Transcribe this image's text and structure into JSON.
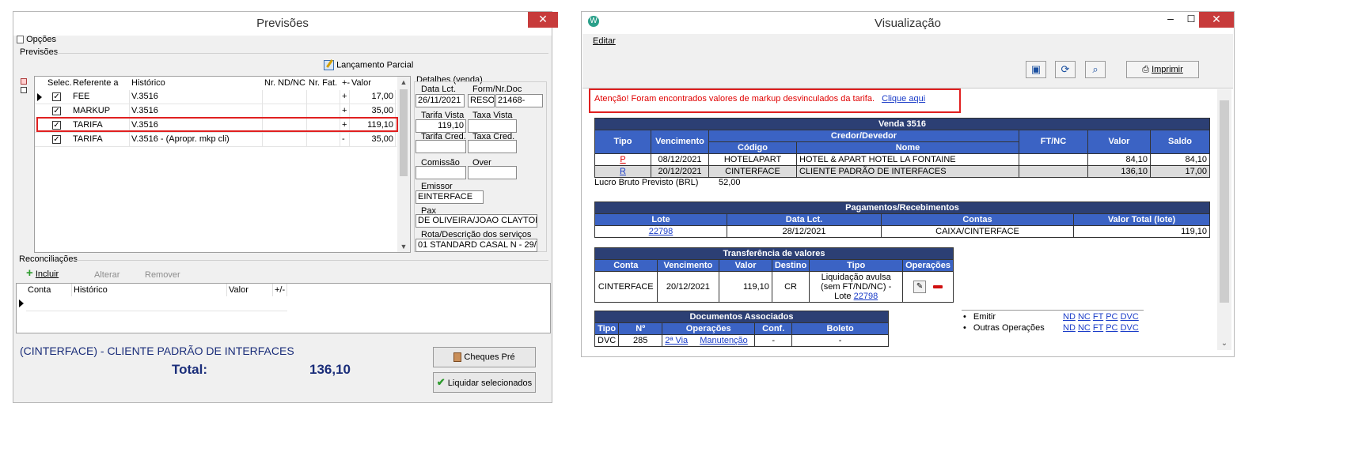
{
  "previsoes": {
    "title": "Previsões",
    "close": "✕",
    "menu_opcoes": "Opções",
    "group_previsoes": "Previsões",
    "lancamento_parcial": "Lançamento Parcial",
    "grid": {
      "headers": [
        "Selec.",
        "Referente a",
        "Histórico",
        "Nr. ND/NC",
        "Nr. Fat.",
        "+-",
        "Valor"
      ],
      "rows": [
        {
          "ref": "FEE",
          "hist": "V.3516",
          "sign": "+",
          "valor": "17,00"
        },
        {
          "ref": "MARKUP",
          "hist": "V.3516",
          "sign": "+",
          "valor": "35,00"
        },
        {
          "ref": "TARIFA",
          "hist": "V.3516",
          "sign": "+",
          "valor": "119,10"
        },
        {
          "ref": "TARIFA",
          "hist": "V.3516 - (Apropr. mkp cli)",
          "sign": "-",
          "valor": "35,00"
        }
      ]
    },
    "detalhes": {
      "title": "Detalhes (venda)",
      "data_lct_label": "Data Lct.",
      "data_lct": "26/11/2021",
      "form_label": "Form/Nr.Doc",
      "form": "RESO",
      "nrdoc": "21468-",
      "tarifa_vista_label": "Tarifa Vista",
      "tarifa_vista": "119,10",
      "taxa_vista_label": "Taxa Vista",
      "tarifa_cred_label": "Tarifa Cred.",
      "taxa_cred_label": "Taxa Cred.",
      "comissao_label": "Comissão",
      "over_label": "Over",
      "emissor_label": "Emissor",
      "emissor": "EINTERFACE",
      "pax_label": "Pax",
      "pax": "DE OLIVEIRA/JOAO CLAYTON",
      "rota_label": "Rota/Descrição dos serviços",
      "rota": "01 STANDARD CASAL  N  - 29/11"
    },
    "reconciliacoes": {
      "title": "Reconciliações",
      "incluir": "Incluir",
      "alterar": "Alterar",
      "remover": "Remover",
      "headers": [
        "Conta",
        "Histórico",
        "Valor",
        "+/-"
      ]
    },
    "client": "(CINTERFACE) - CLIENTE PADRÃO DE INTERFACES",
    "total_label": "Total:",
    "total_value": "136,10",
    "cheques_pre": "Cheques Pré",
    "liquidar": "Liquidar selecionados"
  },
  "visualizacao": {
    "title": "Visualização",
    "menu_editar": "Editar",
    "imprimir": "Imprimir",
    "warning": "Atenção! Foram encontrados valores de markup desvinculados da tarifa.",
    "warning_link": "Clique aqui",
    "venda": {
      "title": "Venda  3516",
      "headers": {
        "tipo": "Tipo",
        "vencimento": "Vencimento",
        "credor": "Credor/Devedor",
        "codigo": "Código",
        "nome": "Nome",
        "ftnc": "FT/NC",
        "valor": "Valor",
        "saldo": "Saldo"
      },
      "rows": [
        {
          "tipo": "P",
          "vencimento": "08/12/2021",
          "codigo": "HOTELAPART",
          "nome": "HOTEL & APART HOTEL LA FONTAINE",
          "ftnc": "",
          "valor": "84,10",
          "saldo": "84,10"
        },
        {
          "tipo": "R",
          "vencimento": "20/12/2021",
          "codigo": "CINTERFACE",
          "nome": "CLIENTE PADRÃO DE INTERFACES",
          "ftnc": "",
          "valor": "136,10",
          "saldo": "17,00"
        }
      ]
    },
    "lucro_label": "Lucro Bruto Previsto (BRL)",
    "lucro_value": "52,00",
    "pagamentos": {
      "title": "Pagamentos/Recebimentos",
      "headers": [
        "Lote",
        "Data Lct.",
        "Contas",
        "Valor Total (lote)"
      ],
      "row": {
        "lote": "22798",
        "data": "28/12/2021",
        "contas": "CAIXA/CINTERFACE",
        "valor": "119,10"
      }
    },
    "transferencia": {
      "title": "Transferência de valores",
      "headers": [
        "Conta",
        "Vencimento",
        "Valor",
        "Destino",
        "Tipo",
        "Operações"
      ],
      "row": {
        "conta": "CINTERFACE",
        "vencimento": "20/12/2021",
        "valor": "119,10",
        "destino": "CR",
        "tipo1": "Liquidação avulsa",
        "tipo2": "(sem FT/ND/NC) -",
        "tipo3": "Lote",
        "lote": "22798"
      }
    },
    "documentos": {
      "title": "Documentos Associados",
      "headers": [
        "Tipo",
        "Nº",
        "Operações",
        "Conf.",
        "Boleto"
      ],
      "row": {
        "tipo": "DVC",
        "numero": "285",
        "op1": "2ª Via",
        "op2": "Manutenção",
        "conf": "-",
        "boleto": "-"
      }
    },
    "acoes": {
      "emitir": "Emitir",
      "outras": "Outras Operações",
      "links": [
        "ND",
        "NC",
        "FT",
        "PC",
        "DVC"
      ]
    }
  },
  "colors": {
    "header_blue": "#3b63c4",
    "header_dark": "#2c3f74",
    "warning_red": "#e00000",
    "close_red": "#c73b3b",
    "highlight_red": "#e02020"
  }
}
